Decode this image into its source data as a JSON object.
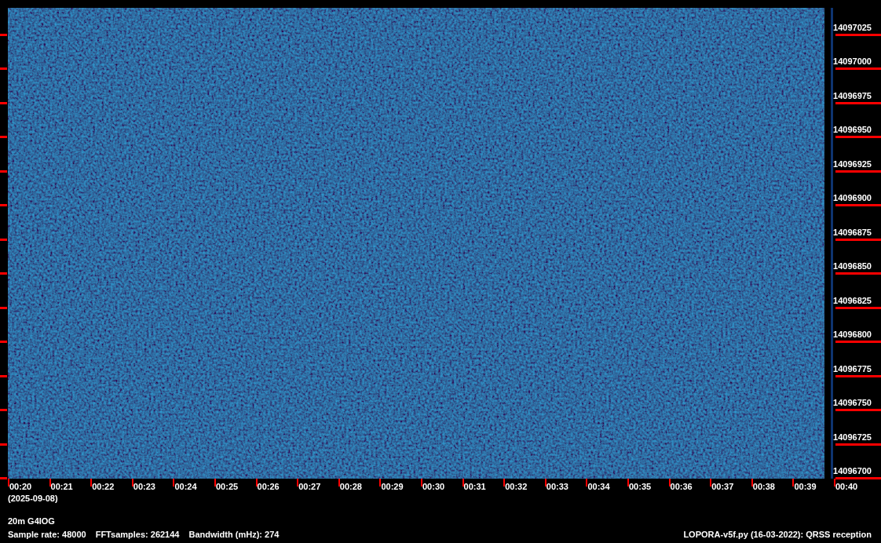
{
  "plot": {
    "frequency_labels": [
      "14097025",
      "14097000",
      "14096975",
      "14096950",
      "14096925",
      "14096900",
      "14096875",
      "14096850",
      "14096825",
      "14096800",
      "14096775",
      "14096750",
      "14096725",
      "14096700"
    ],
    "time_labels": [
      "00:20",
      "00:21",
      "00:22",
      "00:23",
      "00:24",
      "00:25",
      "00:26",
      "00:27",
      "00:28",
      "00:29",
      "00:30",
      "00:31",
      "00:32",
      "00:33",
      "00:34",
      "00:35",
      "00:36",
      "00:37",
      "00:38",
      "00:39",
      "00:40"
    ],
    "date": "(2025-09-08)"
  },
  "footer": {
    "band_call": "20m G4IOG",
    "sample_rate": "Sample rate: 48000",
    "fft_samples": "FFTsamples: 262144",
    "bandwidth": "Bandwidth (mHz): 274",
    "program": "LOPORA-v5f.py (16-03-2022): QRSS reception"
  }
}
